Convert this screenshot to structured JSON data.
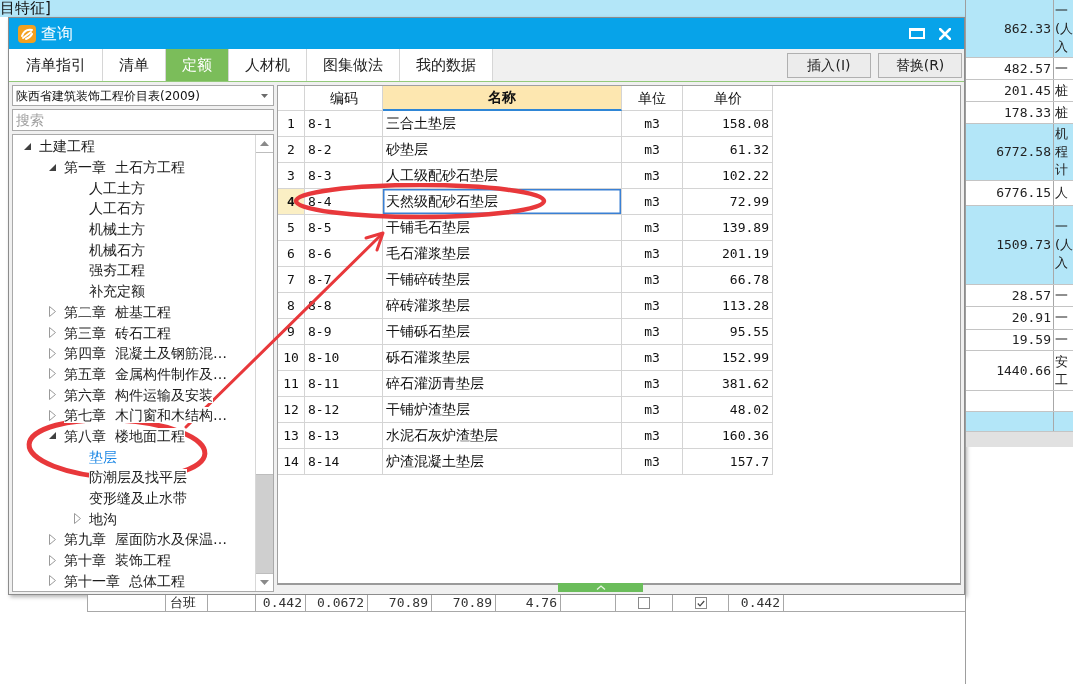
{
  "background": {
    "top_text": "目特征]",
    "side_rows": [
      {
        "amount": "862.33",
        "note_lines": [
          "一",
          "(人",
          "入"
        ],
        "highlighted": true
      },
      {
        "amount": "482.57",
        "note_lines": [
          "一"
        ],
        "highlighted": false
      },
      {
        "amount": "201.45",
        "note_lines": [
          "桩"
        ],
        "highlighted": false
      },
      {
        "amount": "178.33",
        "note_lines": [
          "桩"
        ],
        "highlighted": false
      },
      {
        "amount": "6772.58",
        "note_lines": [
          "机",
          "程",
          "计"
        ],
        "highlighted": true
      },
      {
        "amount": "6776.15",
        "note_lines": [
          "人"
        ],
        "highlighted": false
      },
      {
        "amount": "1509.73",
        "note_lines": [
          "一",
          "(人",
          "入"
        ],
        "highlighted": true
      },
      {
        "amount": "28.57",
        "note_lines": [
          "一"
        ],
        "highlighted": false
      },
      {
        "amount": "20.91",
        "note_lines": [
          "一"
        ],
        "highlighted": false
      },
      {
        "amount": "19.59",
        "note_lines": [
          "一"
        ],
        "highlighted": false
      },
      {
        "amount": "1440.66",
        "note_lines": [
          "安",
          "工"
        ],
        "highlighted": false
      },
      {
        "highlighted": false
      },
      {
        "highlighted": true
      }
    ],
    "bottom_row": [
      {
        "kind": "blank"
      },
      {
        "kind": "text",
        "text": "台班"
      },
      {
        "kind": "blank"
      },
      {
        "kind": "number",
        "text": "0.442"
      },
      {
        "kind": "number",
        "text": "0.0672"
      },
      {
        "kind": "number",
        "text": "70.89"
      },
      {
        "kind": "number",
        "text": "70.89"
      },
      {
        "kind": "number",
        "text": "4.76"
      },
      {
        "kind": "blank"
      },
      {
        "kind": "checkbox",
        "checked": false
      },
      {
        "kind": "checkbox",
        "checked": true
      },
      {
        "kind": "number",
        "text": "0.442"
      }
    ]
  },
  "dialog": {
    "title": "查询",
    "tabs": [
      {
        "label": "清单指引",
        "selected": false
      },
      {
        "label": "清单",
        "selected": false
      },
      {
        "label": "定额",
        "selected": true
      },
      {
        "label": "人材机",
        "selected": false
      },
      {
        "label": "图集做法",
        "selected": false
      },
      {
        "label": "我的数据",
        "selected": false
      }
    ],
    "actions": [
      "插入(I)",
      "替换(R)"
    ],
    "library_select": {
      "value": "陕西省建筑装饰工程价目表(2009)"
    },
    "search": {
      "placeholder": "搜索"
    },
    "tree": [
      {
        "label": "土建工程",
        "expanded": true,
        "selected": false,
        "children": [
          {
            "label": "第一章  土石方工程",
            "expanded": true,
            "selected": false,
            "children": [
              {
                "label": "人工土方",
                "selected": false
              },
              {
                "label": "人工石方",
                "selected": false
              },
              {
                "label": "机械土方",
                "selected": false
              },
              {
                "label": "机械石方",
                "selected": false
              },
              {
                "label": "强夯工程",
                "selected": false
              },
              {
                "label": "补充定额",
                "selected": false
              }
            ]
          },
          {
            "label": "第二章  桩基工程",
            "expanded": false,
            "selected": false
          },
          {
            "label": "第三章  砖石工程",
            "expanded": false,
            "selected": false
          },
          {
            "label": "第四章  混凝土及钢筋混…",
            "expanded": false,
            "selected": false
          },
          {
            "label": "第五章  金属构件制作及…",
            "expanded": false,
            "selected": false
          },
          {
            "label": "第六章  构件运输及安装",
            "expanded": false,
            "selected": false
          },
          {
            "label": "第七章  木门窗和木结构…",
            "expanded": false,
            "selected": false
          },
          {
            "label": "第八章  楼地面工程",
            "expanded": true,
            "selected": false,
            "children": [
              {
                "label": "垫层",
                "selected": true
              },
              {
                "label": "防潮层及找平层",
                "selected": false
              },
              {
                "label": "变形缝及止水带",
                "selected": false
              },
              {
                "label": "地沟",
                "expanded": false,
                "selected": false
              }
            ]
          },
          {
            "label": "第九章  屋面防水及保温…",
            "expanded": false,
            "selected": false
          },
          {
            "label": "第十章  装饰工程",
            "expanded": false,
            "selected": false
          },
          {
            "label": "第十一章  总体工程",
            "expanded": false,
            "selected": false
          }
        ]
      }
    ],
    "table": {
      "columns": [
        {
          "label": "编码",
          "selected": false
        },
        {
          "label": "名称",
          "selected": true
        },
        {
          "label": "单位",
          "selected": false
        },
        {
          "label": "单价",
          "selected": false
        }
      ],
      "rows": [
        {
          "number": "1",
          "code": "8-1",
          "name": "三合土垫层",
          "unit": "m3",
          "price": "158.08",
          "selected": false
        },
        {
          "number": "2",
          "code": "8-2",
          "name": "砂垫层",
          "unit": "m3",
          "price": "61.32",
          "selected": false
        },
        {
          "number": "3",
          "code": "8-3",
          "name": "人工级配砂石垫层",
          "unit": "m3",
          "price": "102.22",
          "selected": false
        },
        {
          "number": "4",
          "code": "8-4",
          "name": "天然级配砂石垫层",
          "unit": "m3",
          "price": "72.99",
          "selected": true
        },
        {
          "number": "5",
          "code": "8-5",
          "name": "干铺毛石垫层",
          "unit": "m3",
          "price": "139.89",
          "selected": false
        },
        {
          "number": "6",
          "code": "8-6",
          "name": "毛石灌浆垫层",
          "unit": "m3",
          "price": "201.19",
          "selected": false
        },
        {
          "number": "7",
          "code": "8-7",
          "name": "干铺碎砖垫层",
          "unit": "m3",
          "price": "66.78",
          "selected": false
        },
        {
          "number": "8",
          "code": "8-8",
          "name": "碎砖灌浆垫层",
          "unit": "m3",
          "price": "113.28",
          "selected": false
        },
        {
          "number": "9",
          "code": "8-9",
          "name": "干铺砾石垫层",
          "unit": "m3",
          "price": "95.55",
          "selected": false
        },
        {
          "number": "10",
          "code": "8-10",
          "name": "砾石灌浆垫层",
          "unit": "m3",
          "price": "152.99",
          "selected": false
        },
        {
          "number": "11",
          "code": "8-11",
          "name": "碎石灌沥青垫层",
          "unit": "m3",
          "price": "381.62",
          "selected": false
        },
        {
          "number": "12",
          "code": "8-12",
          "name": "干铺炉渣垫层",
          "unit": "m3",
          "price": "48.02",
          "selected": false
        },
        {
          "number": "13",
          "code": "8-13",
          "name": "水泥石灰炉渣垫层",
          "unit": "m3",
          "price": "160.36",
          "selected": false
        },
        {
          "number": "14",
          "code": "8-14",
          "name": "炉渣混凝土垫层",
          "unit": "m3",
          "price": "157.7",
          "selected": false
        }
      ]
    }
  }
}
